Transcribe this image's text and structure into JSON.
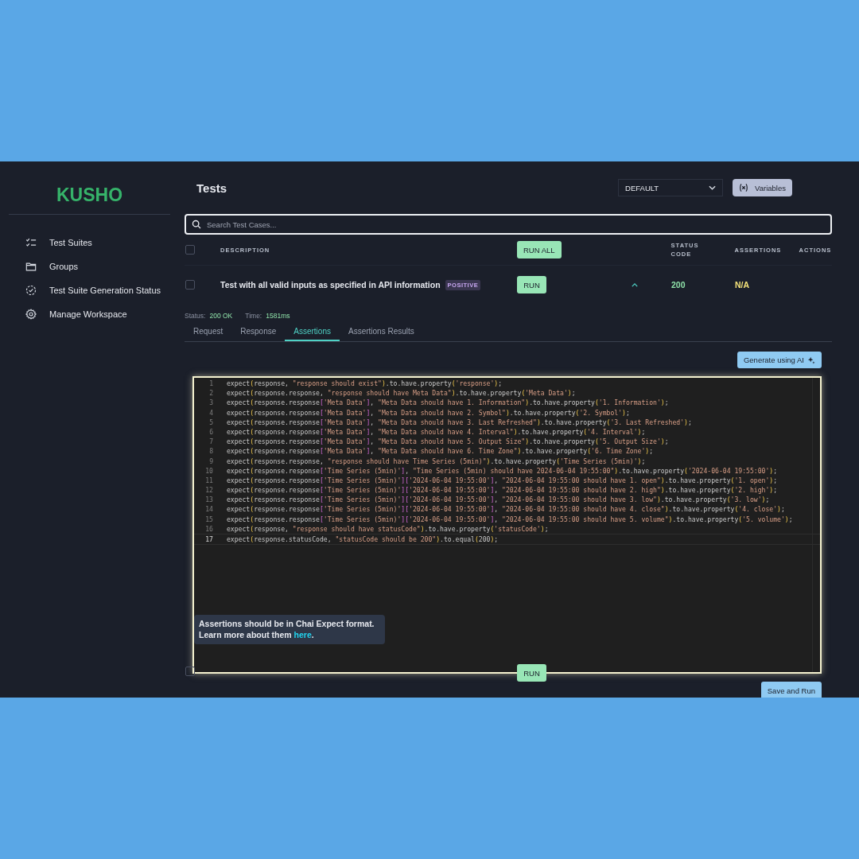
{
  "sidebar": {
    "logo": "KUSHO",
    "items": [
      {
        "kind": "checklist",
        "label": "Test Suites"
      },
      {
        "kind": "folder",
        "label": "Groups"
      },
      {
        "kind": "status",
        "label": "Test Suite Generation Status"
      },
      {
        "kind": "settings",
        "label": "Manage Workspace"
      }
    ]
  },
  "header": {
    "title": "Tests",
    "environment": "DEFAULT",
    "variables_button": "Variables"
  },
  "search": {
    "placeholder": "Search Test Cases..."
  },
  "table": {
    "all_checked": false,
    "columns": {
      "description": "DESCRIPTION",
      "run_all": "RUN ALL",
      "status_code": "STATUS CODE",
      "assertions": "ASSERTIONS",
      "actions": "ACTIONS"
    },
    "rows": [
      {
        "checked": false,
        "description": "Test with all valid inputs as specified in API information",
        "tag": "POSITIVE",
        "run": "RUN",
        "expanded": true,
        "status_code": "200",
        "assertions": "N/A"
      }
    ]
  },
  "details": {
    "status_label": "Status:",
    "status": "200 OK",
    "time_label": "Time:",
    "time": "1581ms",
    "tabs": [
      {
        "label": "Request",
        "selected": false
      },
      {
        "label": "Response",
        "selected": false
      },
      {
        "label": "Assertions",
        "selected": true
      },
      {
        "label": "Assertions Results",
        "selected": false
      }
    ],
    "generate_button": "Generate using AI",
    "code_lines": [
      {
        "number": "1",
        "text": "expect(response, \"response should exist\").to.have.property('response');",
        "active": false
      },
      {
        "number": "2",
        "text": "expect(response.response, \"response should have Meta Data\").to.have.property('Meta Data');",
        "active": false
      },
      {
        "number": "3",
        "text": "expect(response.response['Meta Data'], \"Meta Data should have 1. Information\").to.have.property('1. Information');",
        "active": false
      },
      {
        "number": "4",
        "text": "expect(response.response['Meta Data'], \"Meta Data should have 2. Symbol\").to.have.property('2. Symbol');",
        "active": false
      },
      {
        "number": "5",
        "text": "expect(response.response['Meta Data'], \"Meta Data should have 3. Last Refreshed\").to.have.property('3. Last Refreshed');",
        "active": false
      },
      {
        "number": "6",
        "text": "expect(response.response['Meta Data'], \"Meta Data should have 4. Interval\").to.have.property('4. Interval');",
        "active": false
      },
      {
        "number": "7",
        "text": "expect(response.response['Meta Data'], \"Meta Data should have 5. Output Size\").to.have.property('5. Output Size');",
        "active": false
      },
      {
        "number": "8",
        "text": "expect(response.response['Meta Data'], \"Meta Data should have 6. Time Zone\").to.have.property('6. Time Zone');",
        "active": false
      },
      {
        "number": "9",
        "text": "expect(response.response, \"response should have Time Series (5min)\").to.have.property('Time Series (5min)');",
        "active": false
      },
      {
        "number": "10",
        "text": "expect(response.response['Time Series (5min)'], \"Time Series (5min) should have 2024-06-04 19:55:00\").to.have.property('2024-06-04 19:55:00');",
        "active": false
      },
      {
        "number": "11",
        "text": "expect(response.response['Time Series (5min)']['2024-06-04 19:55:00'], \"2024-06-04 19:55:00 should have 1. open\").to.have.property('1. open');",
        "active": false
      },
      {
        "number": "12",
        "text": "expect(response.response['Time Series (5min)']['2024-06-04 19:55:00'], \"2024-06-04 19:55:00 should have 2. high\").to.have.property('2. high');",
        "active": false
      },
      {
        "number": "13",
        "text": "expect(response.response['Time Series (5min)']['2024-06-04 19:55:00'], \"2024-06-04 19:55:00 should have 3. low\").to.have.property('3. low');",
        "active": false
      },
      {
        "number": "14",
        "text": "expect(response.response['Time Series (5min)']['2024-06-04 19:55:00'], \"2024-06-04 19:55:00 should have 4. close\").to.have.property('4. close');",
        "active": false
      },
      {
        "number": "15",
        "text": "expect(response.response['Time Series (5min)']['2024-06-04 19:55:00'], \"2024-06-04 19:55:00 should have 5. volume\").to.have.property('5. volume');",
        "active": false
      },
      {
        "number": "16",
        "text": "expect(response, \"response should have statusCode\").to.have.property('statusCode');",
        "active": false
      },
      {
        "number": "17",
        "text": "expect(response.statusCode, \"statusCode should be 200\").to.equal(200);",
        "active": true
      }
    ],
    "hint": "Assertions should be in Chai Expect format. Learn more about them",
    "hint_link": "here",
    "hint_end": ".",
    "save_button": "Save and Run"
  },
  "next_row": {
    "checked": false,
    "run": "RUN"
  }
}
